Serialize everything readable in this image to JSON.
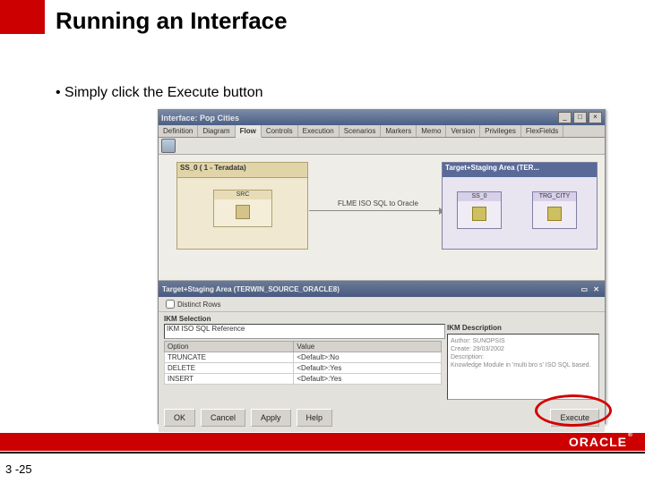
{
  "slide": {
    "title": "Running an Interface",
    "bullet": "Simply click the Execute button",
    "page_number": "3 -25",
    "footer_brand": "ORACLE"
  },
  "window": {
    "title": "Interface: Pop Cities",
    "tabs": [
      "Definition",
      "Diagram",
      "Flow",
      "Controls",
      "Execution",
      "Scenarios",
      "Markers",
      "Memo",
      "Version",
      "Privileges",
      "FlexFields"
    ],
    "active_tab": "Flow",
    "source": {
      "label": "SS_0 ( 1 - Teradata)",
      "table": "SRC"
    },
    "target": {
      "label": "Target+Staging Area (TER...",
      "table_a": "SS_0",
      "table_b": "TRG_CITY"
    },
    "arrow_label": "FLME ISO SQL to Oracle",
    "staging_header": "Target+Staging Area (TERWIN_SOURCE_ORACLE8)",
    "distinct_label": "Distinct Rows",
    "ikm_section": "IKM Selection",
    "ikm_value": "IKM ISO SQL Reference",
    "options_header_left": "Option",
    "options_header_right": "Value",
    "options": [
      {
        "opt": "TRUNCATE",
        "val": "<Default>:No"
      },
      {
        "opt": "DELETE",
        "val": "<Default>:Yes"
      },
      {
        "opt": "INSERT",
        "val": "<Default>:Yes"
      }
    ],
    "desc_header": "IKM Description",
    "desc_lines": [
      "Author:  SUNOPSIS",
      "Create:  29/03/2002",
      "Description:",
      "Knowledge Module in 'multi bro s' ISO SQL based."
    ],
    "buttons": {
      "ok": "OK",
      "cancel": "Cancel",
      "apply": "Apply",
      "help": "Help",
      "execute": "Execute"
    }
  }
}
